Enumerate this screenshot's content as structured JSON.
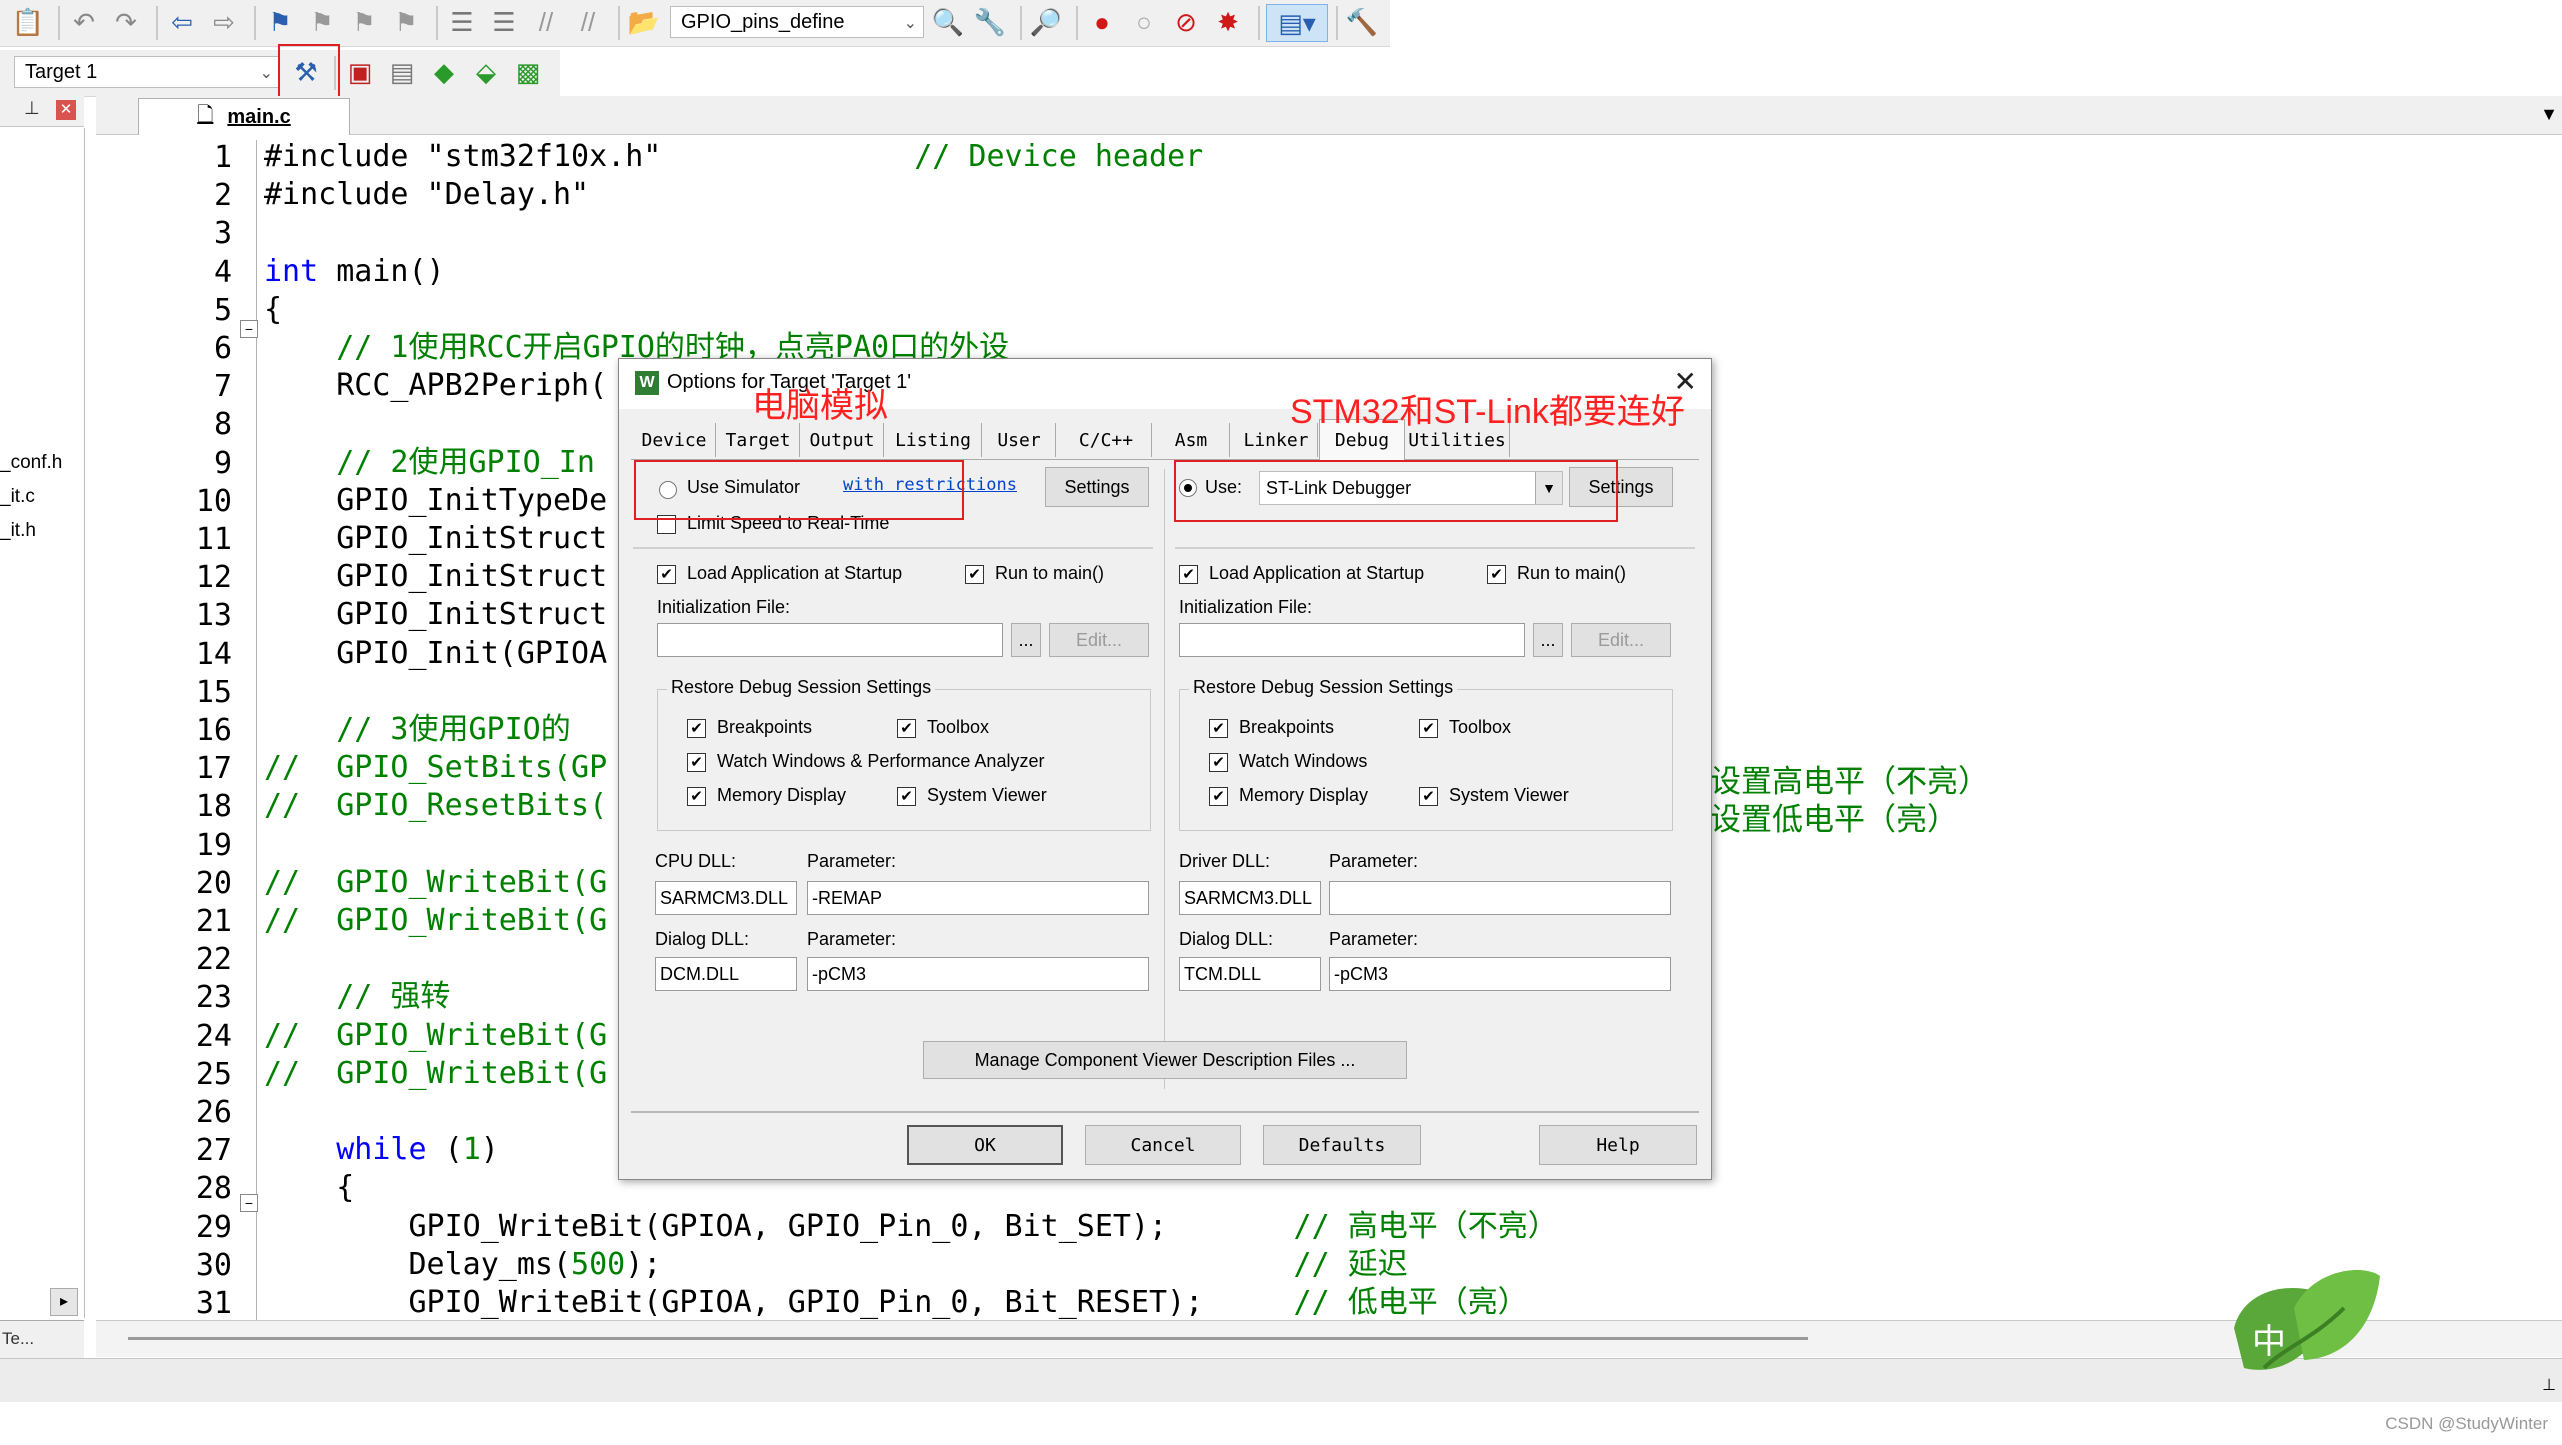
{
  "toolbar1": {
    "project_combo": "GPIO_pins_define"
  },
  "toolbar2": {
    "target_combo": "Target 1"
  },
  "editor": {
    "file_tab": "main.c",
    "lines": [
      {
        "n": "1",
        "html": "#include \"stm32f10x.h\"              // Device header"
      },
      {
        "n": "2",
        "html": "#include \"Delay.h\""
      },
      {
        "n": "3",
        "html": ""
      },
      {
        "n": "4",
        "html": "int main()"
      },
      {
        "n": "5",
        "html": "{"
      },
      {
        "n": "6",
        "html": "    // 1使用RCC开启GPIO的时钟，点亮PA0口的外设"
      },
      {
        "n": "7",
        "html": "    RCC_APB2Periph("
      },
      {
        "n": "8",
        "html": ""
      },
      {
        "n": "9",
        "html": "    // 2使用GPIO_In"
      },
      {
        "n": "10",
        "html": "    GPIO_InitTypeDe"
      },
      {
        "n": "11",
        "html": "    GPIO_InitStruct"
      },
      {
        "n": "12",
        "html": "    GPIO_InitStruct"
      },
      {
        "n": "13",
        "html": "    GPIO_InitStruct"
      },
      {
        "n": "14",
        "html": "    GPIO_Init(GPIOA"
      },
      {
        "n": "15",
        "html": ""
      },
      {
        "n": "16",
        "html": "    // 3使用GPIO的"
      },
      {
        "n": "17",
        "html": "//  GPIO_SetBits(GP"
      },
      {
        "n": "18",
        "html": "//  GPIO_ResetBits("
      },
      {
        "n": "19",
        "html": ""
      },
      {
        "n": "20",
        "html": "//  GPIO_WriteBit(G"
      },
      {
        "n": "21",
        "html": "//  GPIO_WriteBit(G"
      },
      {
        "n": "22",
        "html": ""
      },
      {
        "n": "23",
        "html": "    // 强转"
      },
      {
        "n": "24",
        "html": "//  GPIO_WriteBit(G"
      },
      {
        "n": "25",
        "html": "//  GPIO_WriteBit(G"
      },
      {
        "n": "26",
        "html": ""
      },
      {
        "n": "27",
        "html": "    while (1)"
      },
      {
        "n": "28",
        "html": "    {"
      },
      {
        "n": "29",
        "html": "        GPIO_WriteBit(GPIOA, GPIO_Pin_0, Bit_SET);       // 高电平（不亮）"
      },
      {
        "n": "30",
        "html": "        Delay_ms(500);                                   // 延迟"
      },
      {
        "n": "31",
        "html": "        GPIO_WriteBit(GPIOA, GPIO_Pin_0, Bit_RESET);     // 低电平（亮）"
      }
    ],
    "right_comment_17": "设置高电平（不亮）",
    "right_comment_18": "设置低电平（亮）"
  },
  "left_panel": {
    "files": [
      "_conf.h",
      "_it.c",
      "_it.h"
    ],
    "bottom_tab": "Te..."
  },
  "dialog": {
    "title": "Options for Target 'Target 1'",
    "tabs": [
      "Device",
      "Target",
      "Output",
      "Listing",
      "User",
      "C/C++",
      "Asm",
      "Linker",
      "Debug",
      "Utilities"
    ],
    "active_tab": "Debug",
    "left": {
      "use_simulator": "Use Simulator",
      "with_restrictions": "with restrictions",
      "settings": "Settings",
      "limit_speed": "Limit Speed to Real-Time",
      "load_app": "Load Application at Startup",
      "run_to_main": "Run to main()",
      "init_file": "Initialization File:",
      "browse": "...",
      "edit": "Edit...",
      "restore_group": "Restore Debug Session Settings",
      "breakpoints": "Breakpoints",
      "toolbox": "Toolbox",
      "watch_windows": "Watch Windows & Performance Analyzer",
      "memory_display": "Memory Display",
      "system_viewer": "System Viewer",
      "cpu_dll_label": "CPU DLL:",
      "param_label": "Parameter:",
      "cpu_dll": "SARMCM3.DLL",
      "cpu_param": "-REMAP",
      "dialog_dll_label": "Dialog DLL:",
      "dialog_dll": "DCM.DLL",
      "dialog_param": "-pCM3"
    },
    "right": {
      "use": "Use:",
      "debugger": "ST-Link Debugger",
      "settings": "Settings",
      "load_app": "Load Application at Startup",
      "run_to_main": "Run to main()",
      "init_file": "Initialization File:",
      "browse": "...",
      "edit": "Edit...",
      "restore_group": "Restore Debug Session Settings",
      "breakpoints": "Breakpoints",
      "toolbox": "Toolbox",
      "watch_windows": "Watch Windows",
      "memory_display": "Memory Display",
      "system_viewer": "System Viewer",
      "driver_dll_label": "Driver DLL:",
      "param_label": "Parameter:",
      "driver_dll": "SARMCM3.DLL",
      "driver_param": "",
      "dialog_dll_label": "Dialog DLL:",
      "dialog_dll": "TCM.DLL",
      "dialog_param": "-pCM3"
    },
    "manage_btn": "Manage Component Viewer Description Files ...",
    "ok": "OK",
    "cancel": "Cancel",
    "defaults": "Defaults",
    "help": "Help"
  },
  "annotations": {
    "simulator_note": "电脑模拟",
    "stlink_note": "STM32和ST-Link都要连好"
  },
  "watermark": {
    "ime": "中",
    "credit": "CSDN @StudyWinter"
  },
  "colors": {
    "annotation_red": "#ff2020",
    "keyword_blue": "#0000ff",
    "comment_green": "#008000"
  }
}
